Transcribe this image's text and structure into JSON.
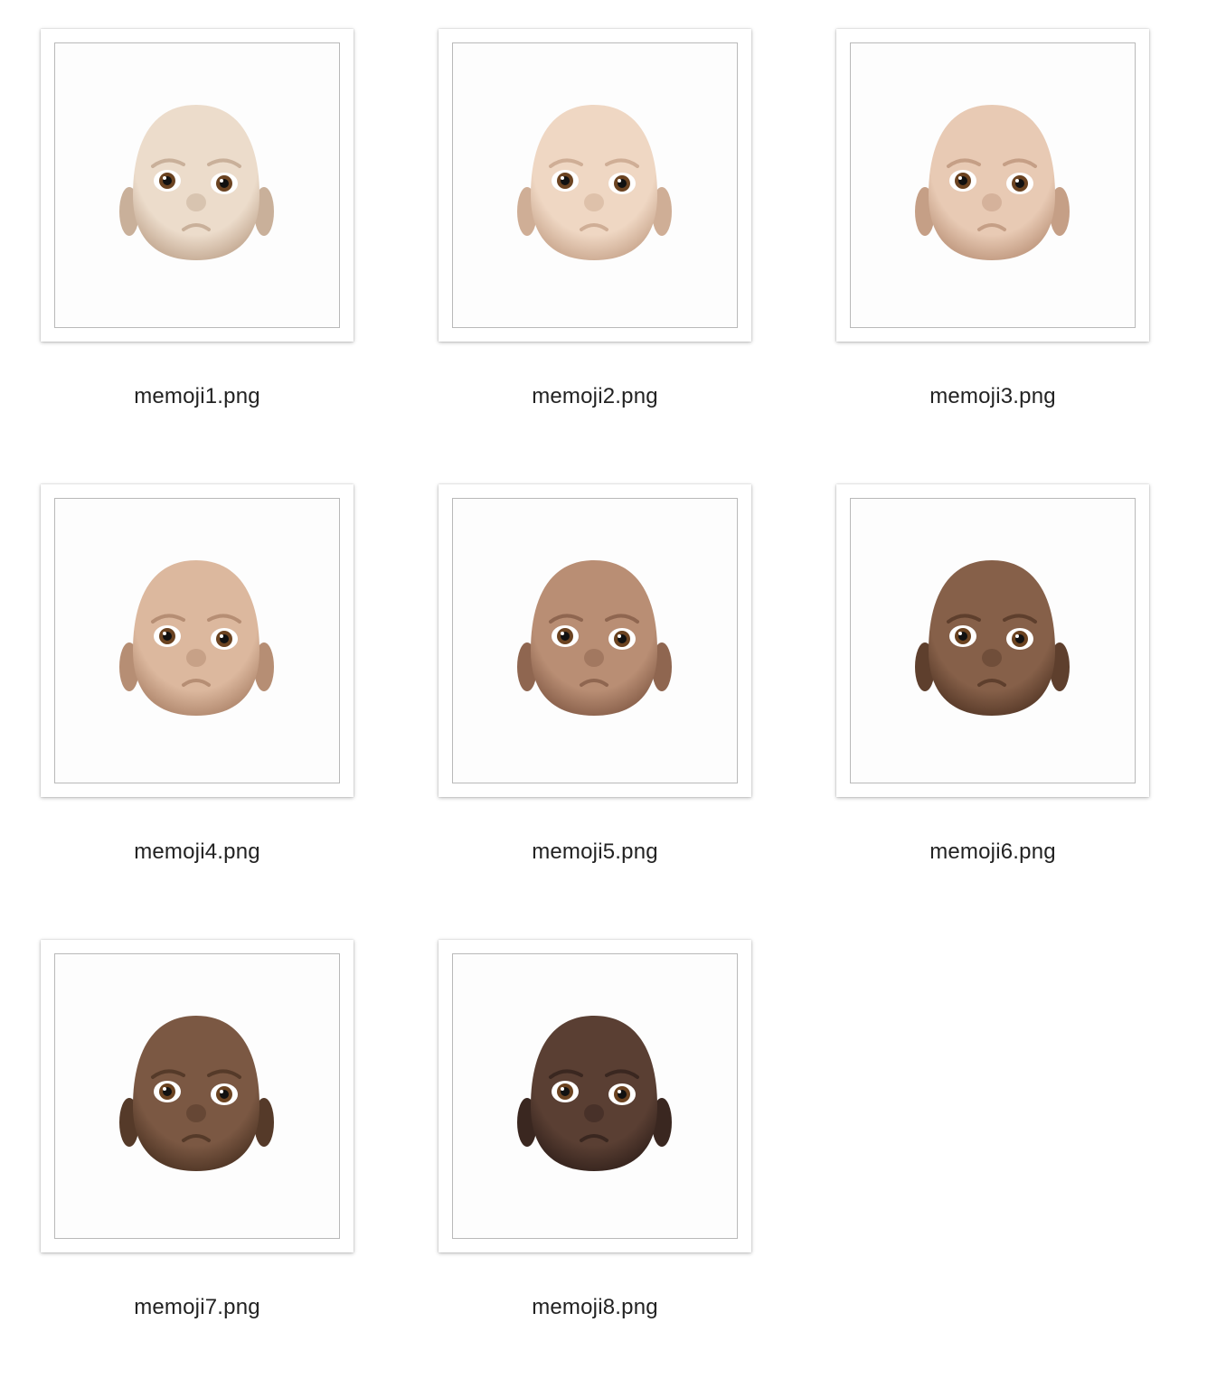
{
  "files": [
    {
      "name": "memoji1.png",
      "skin": "#ecdccb",
      "skin_shade": "#c9b09a"
    },
    {
      "name": "memoji2.png",
      "skin": "#efd7c3",
      "skin_shade": "#cfae96"
    },
    {
      "name": "memoji3.png",
      "skin": "#e8cab4",
      "skin_shade": "#c59f86"
    },
    {
      "name": "memoji4.png",
      "skin": "#dcb89e",
      "skin_shade": "#b68e74"
    },
    {
      "name": "memoji5.png",
      "skin": "#b98e74",
      "skin_shade": "#8f6650"
    },
    {
      "name": "memoji6.png",
      "skin": "#866049",
      "skin_shade": "#5e3f2d"
    },
    {
      "name": "memoji7.png",
      "skin": "#7b5843",
      "skin_shade": "#553a29"
    },
    {
      "name": "memoji8.png",
      "skin": "#5a3f33",
      "skin_shade": "#3a2720"
    }
  ]
}
